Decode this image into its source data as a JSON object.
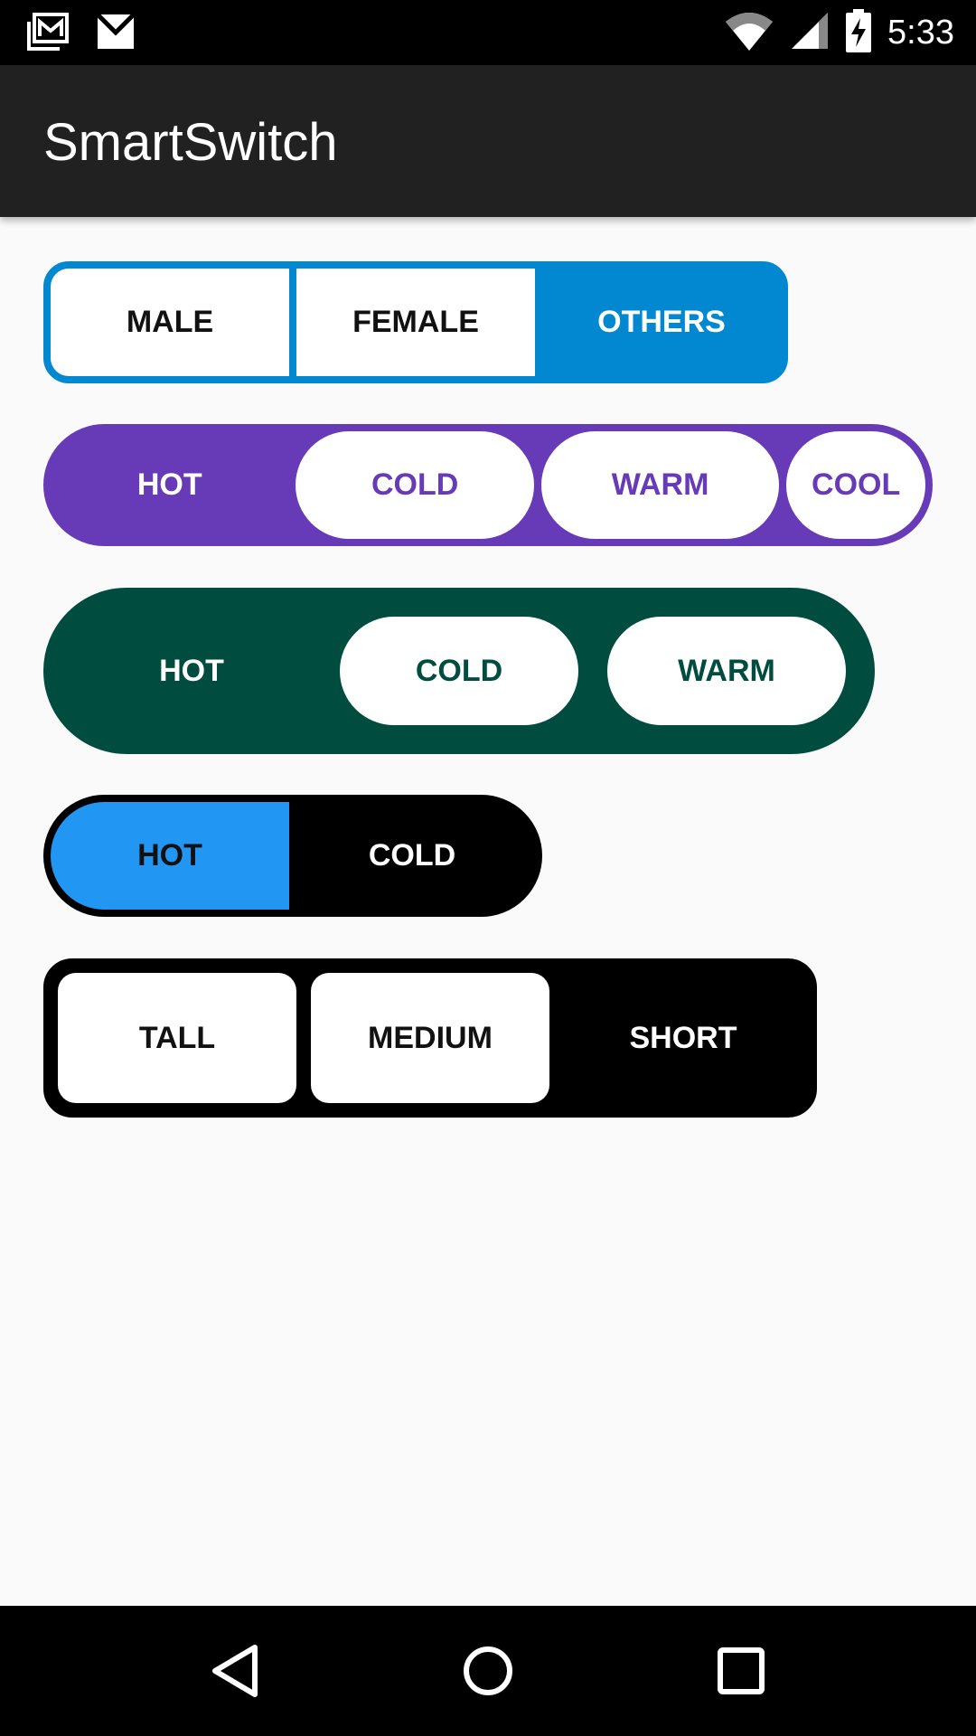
{
  "status_bar": {
    "time": "5:33",
    "left_icons": [
      "gallery-mail-icon",
      "gmail-icon"
    ],
    "right_icons": [
      "wifi-icon",
      "signal-icon",
      "battery-charging-icon"
    ]
  },
  "app_bar": {
    "title": "SmartSwitch"
  },
  "switches": [
    {
      "options": [
        "MALE",
        "FEMALE",
        "OTHERS"
      ],
      "selected": "OTHERS",
      "color": "#0288d1"
    },
    {
      "options": [
        "HOT",
        "COLD",
        "WARM",
        "COOL"
      ],
      "selected": "HOT",
      "color": "#673ab7"
    },
    {
      "options": [
        "HOT",
        "COLD",
        "WARM"
      ],
      "selected": "HOT",
      "color": "#004d40"
    },
    {
      "options": [
        "HOT",
        "COLD"
      ],
      "selected": "HOT",
      "color": "#2196f3"
    },
    {
      "options": [
        "TALL",
        "MEDIUM",
        "SHORT"
      ],
      "selected": "SHORT",
      "color": "#000000"
    }
  ],
  "nav_bar": {
    "buttons": [
      "back-icon",
      "home-icon",
      "recents-icon"
    ]
  }
}
